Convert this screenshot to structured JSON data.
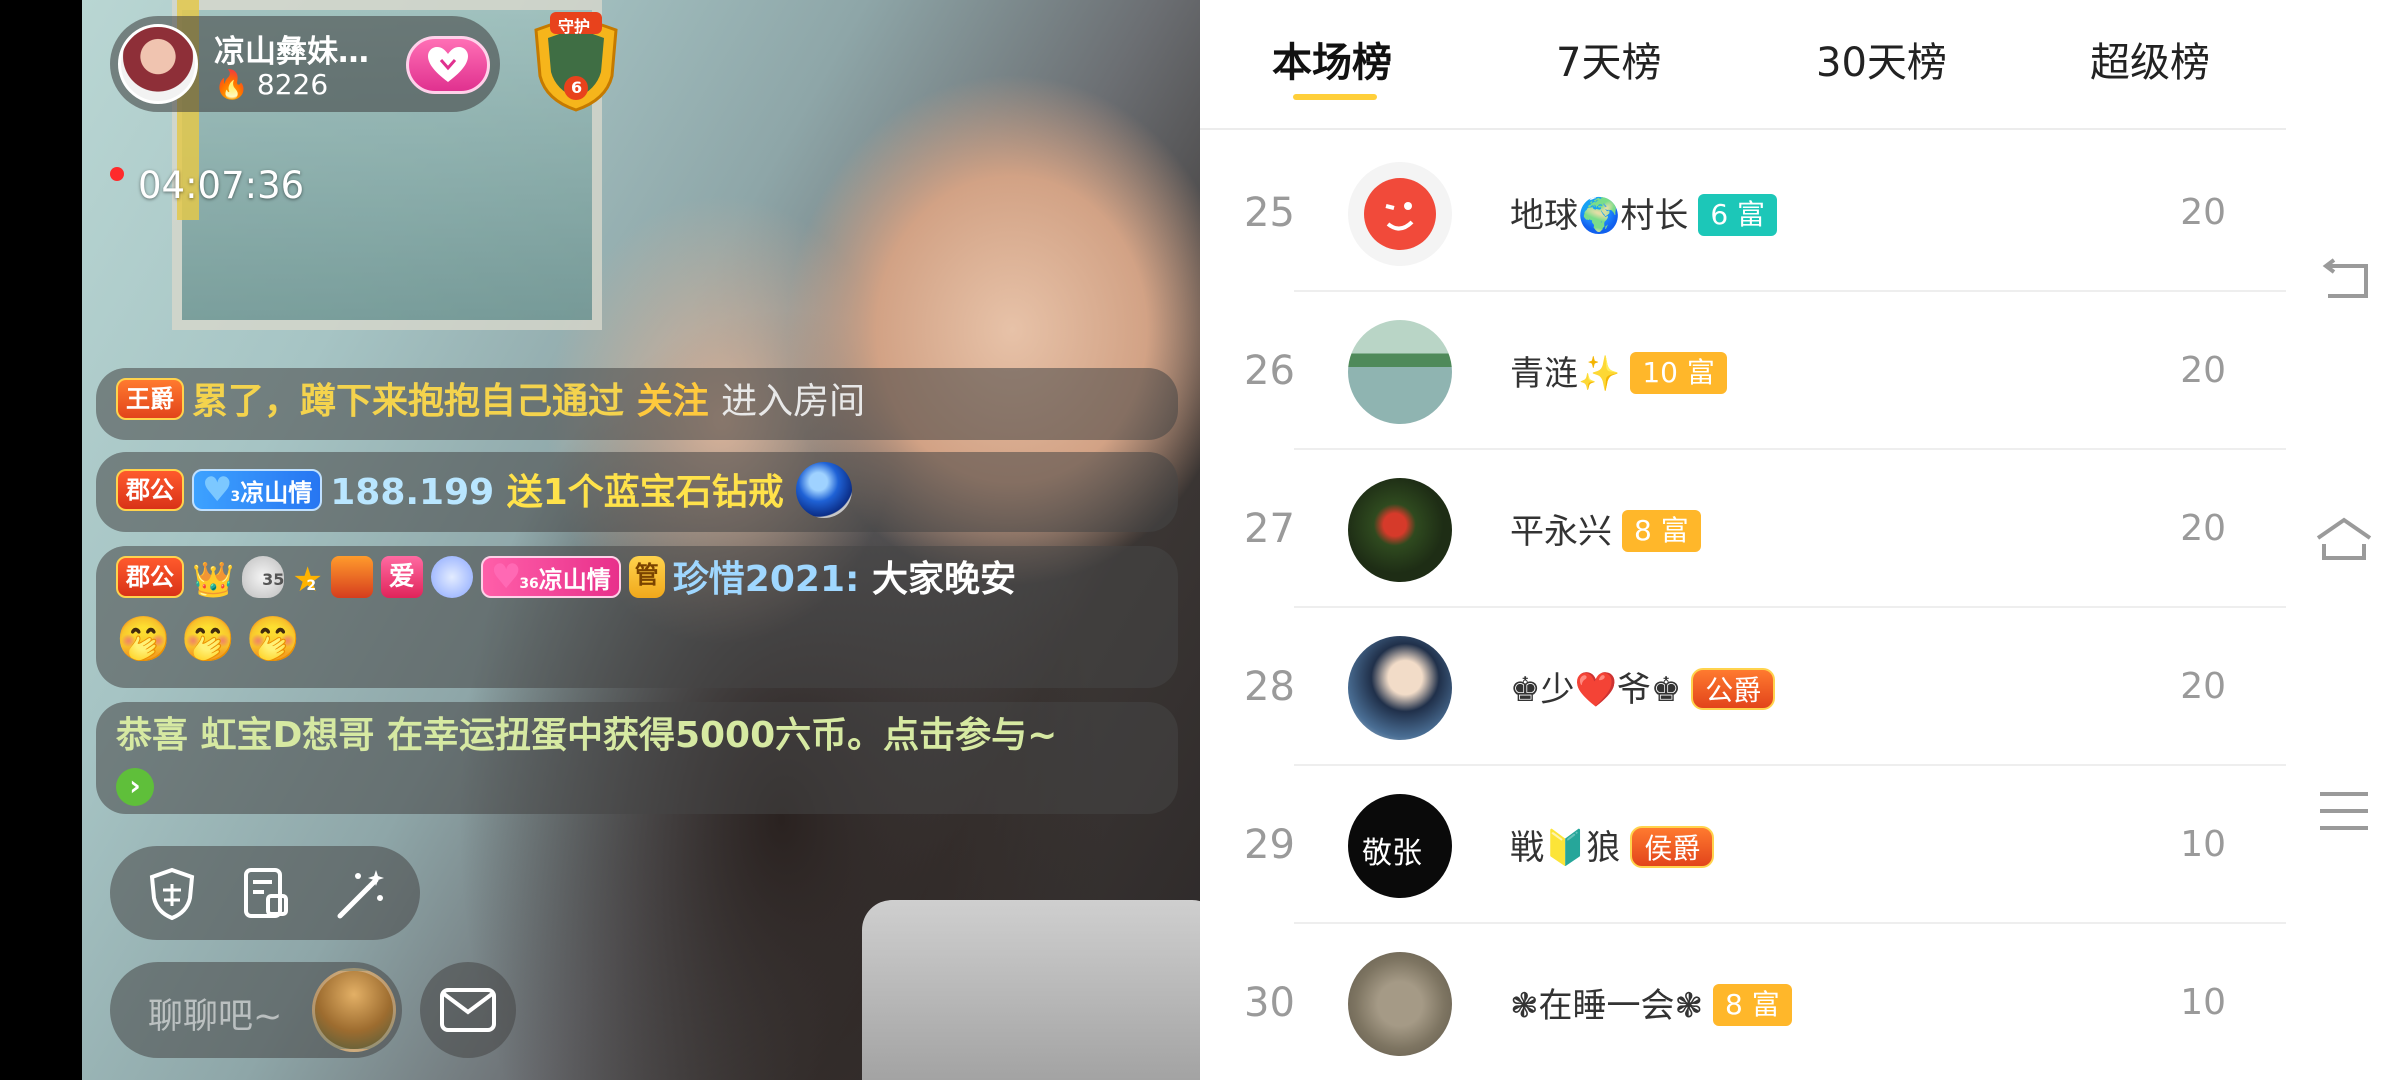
{
  "host": {
    "name": "凉山彝妹…",
    "fans": "8226",
    "follow_icon": "heart-icon",
    "guard_badge_label": "守护",
    "guard_badge_level": "6"
  },
  "live": {
    "timer": "04:07:36"
  },
  "chat": {
    "row1": {
      "badge": "王爵",
      "user": "累了，蹲下来抱抱自己通过",
      "action": "关注",
      "suffix": "进入房间"
    },
    "row2": {
      "badge": "郡公",
      "fan_level": "3",
      "fan_club": "凉山情",
      "user": "188.199",
      "gift": "送1个蓝宝石钻戒"
    },
    "row3": {
      "badge": "郡公",
      "shield_level": "35",
      "star_level": "2",
      "love_label": "爱",
      "fan_level": "36",
      "fan_club": "凉山情",
      "role": "管",
      "user": "珍惜2021:",
      "message": "大家晚安",
      "emoji": "🤭"
    },
    "row4": {
      "text": "恭喜 虹宝D想哥 在幸运扭蛋中获得5000六币。点击参与~"
    }
  },
  "input": {
    "placeholder": "聊聊吧~"
  },
  "leaderboard": {
    "tabs": [
      "本场榜",
      "7天榜",
      "30天榜",
      "超级榜"
    ],
    "active_tab": "本场榜",
    "rows": [
      {
        "rank": "25",
        "name": "地球🌍村长",
        "level": "6 富",
        "score": "20"
      },
      {
        "rank": "26",
        "name": "青涟✨",
        "level": "10 富",
        "score": "20"
      },
      {
        "rank": "27",
        "name": "平永兴",
        "level": "8 富",
        "score": "20"
      },
      {
        "rank": "28",
        "name": "♚少❤️爷♚",
        "level": "公爵",
        "score": "20"
      },
      {
        "rank": "29",
        "name": "戦🔰狼",
        "level": "侯爵",
        "score": "10"
      },
      {
        "rank": "30",
        "name": "❃在睡一会❃",
        "level": "8 富",
        "score": "10"
      }
    ],
    "row4_avatar_text": "敬张"
  },
  "colors": {
    "tab_indicator": "#ffcf3a",
    "level_teal": "#1cc7b8",
    "level_orange": "#ffb72a",
    "noble_red": "#ff5a2c"
  }
}
